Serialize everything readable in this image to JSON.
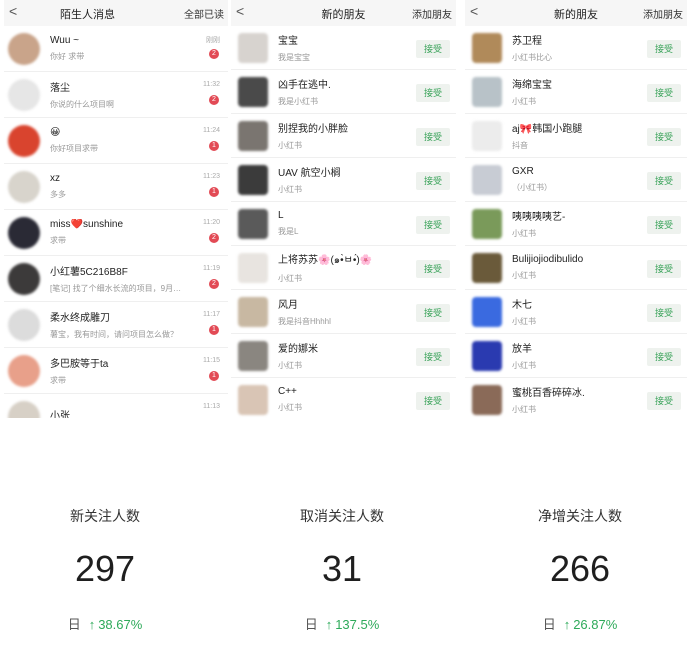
{
  "panel1": {
    "back": "<",
    "title": "陌生人消息",
    "action": "全部已读",
    "rows": [
      {
        "name": "Wuu ~",
        "sub": "你好 求带",
        "time": "刚刚",
        "badge": "2",
        "color": "#c9a48a"
      },
      {
        "name": "落尘",
        "sub": "你说的什么项目啊",
        "time": "11:32",
        "badge": "2",
        "color": "#e6e6e6"
      },
      {
        "name": "😀",
        "sub": "你好项目求带",
        "time": "11:24",
        "badge": "1",
        "color": "#d9442e"
      },
      {
        "name": "xz",
        "sub": "多多",
        "time": "11:23",
        "badge": "1",
        "color": "#d8d4cc"
      },
      {
        "name": "miss❤️sunshine",
        "sub": "求带",
        "time": "11:20",
        "badge": "2",
        "color": "#2a2a35"
      },
      {
        "name": "小红薯5C216B8F",
        "sub": "[笔记] 找了个细水长流的项目，9月…",
        "time": "11:19",
        "badge": "2",
        "color": "#3c3a3a"
      },
      {
        "name": "柔水终成雕刀",
        "sub": "薯宝，我有时间，请问项目怎么做？",
        "time": "11:17",
        "badge": "1",
        "color": "#dcdcdc"
      },
      {
        "name": "多巴胺等于ta",
        "sub": "求带",
        "time": "11:15",
        "badge": "1",
        "color": "#e8a08a"
      },
      {
        "name": "小张",
        "sub": "",
        "time": "11:13",
        "badge": "",
        "color": "#d7d0c6"
      }
    ]
  },
  "panel2": {
    "back": "<",
    "title": "新的朋友",
    "action": "添加朋友",
    "accept": "接受",
    "rows": [
      {
        "name": "宝宝",
        "sub": "我是宝宝",
        "color": "#d7d3cf"
      },
      {
        "name": "凶手在逃中.",
        "sub": "我是小红书",
        "color": "#4a4a4a"
      },
      {
        "name": "别捏我的小胖脸",
        "sub": "小红书",
        "color": "#7a7570"
      },
      {
        "name": "UAV 航空小榈",
        "sub": "小红书",
        "color": "#3b3b3b"
      },
      {
        "name": "L",
        "sub": "我是L",
        "color": "#5a5a5a"
      },
      {
        "name": "上将苏苏🌸(๑•̀ㅂ•́)🌸",
        "sub": "小红书",
        "color": "#e8e4e0"
      },
      {
        "name": "风月",
        "sub": "我是抖音Hhhhl",
        "color": "#c8b8a2"
      },
      {
        "name": "爱的娜米",
        "sub": "小红书",
        "color": "#8a8680"
      },
      {
        "name": "C++",
        "sub": "小红书",
        "color": "#d9c5b5"
      }
    ]
  },
  "panel3": {
    "back": "<",
    "title": "新的朋友",
    "action": "添加朋友",
    "accept": "接受",
    "rows": [
      {
        "name": "苏卫程",
        "sub": "小红书比心",
        "color": "#b08a5a"
      },
      {
        "name": "海绵宝宝",
        "sub": "小红书",
        "color": "#b8c2c8"
      },
      {
        "name": "aj🎀韩国小跑腿",
        "sub": "抖音",
        "color": "#ececec"
      },
      {
        "name": "GXR",
        "sub": "（小红书）",
        "color": "#c8ccd4"
      },
      {
        "name": "咦咦咦咦艺-",
        "sub": "小红书",
        "color": "#7a9a5a"
      },
      {
        "name": "Bulijiojiodibulido",
        "sub": "小红书",
        "color": "#6a5a3a"
      },
      {
        "name": "木七",
        "sub": "小红书",
        "color": "#3a6ae0"
      },
      {
        "name": "放羊",
        "sub": "小红书",
        "color": "#2a3ab0"
      },
      {
        "name": "蜜桃百香碎碎冰.",
        "sub": "小红书",
        "color": "#8a6a58"
      }
    ]
  },
  "stats": [
    {
      "label": "新关注人数",
      "value": "297",
      "period": "日",
      "arrow": "↑",
      "change": "38.67%"
    },
    {
      "label": "取消关注人数",
      "value": "31",
      "period": "日",
      "arrow": "↑",
      "change": "137.5%"
    },
    {
      "label": "净增关注人数",
      "value": "266",
      "period": "日",
      "arrow": "↑",
      "change": "26.87%"
    }
  ],
  "colors": {
    "accent_green": "#2eaa5a",
    "badge_red": "#e24a55"
  }
}
